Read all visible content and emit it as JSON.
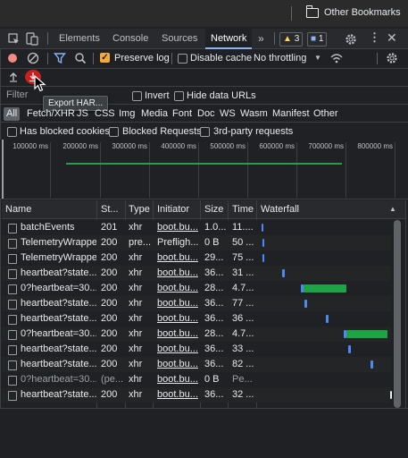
{
  "browser": {
    "bookmarks_label": "Other Bookmarks"
  },
  "devtools": {
    "tabs": [
      "Elements",
      "Console",
      "Sources",
      "Network"
    ],
    "active_tab": "Network",
    "warnings_count": "3",
    "messages_count": "1"
  },
  "toolbar": {
    "preserve_log": "Preserve log",
    "disable_cache": "Disable cache",
    "throttling": "No throttling",
    "filter_placeholder": "Filter",
    "invert": "Invert",
    "hide_data_urls": "Hide data URLs",
    "tooltip": "Export HAR..."
  },
  "filters": [
    "All",
    "Fetch/XHR",
    "JS",
    "CSS",
    "Img",
    "Media",
    "Font",
    "Doc",
    "WS",
    "Wasm",
    "Manifest",
    "Other"
  ],
  "options": {
    "blocked_cookies": "Has blocked cookies",
    "blocked_requests": "Blocked Requests",
    "third_party": "3rd-party requests"
  },
  "overview": {
    "ticks": [
      "100000 ms",
      "200000 ms",
      "300000 ms",
      "400000 ms",
      "500000 ms",
      "600000 ms",
      "700000 ms",
      "800000 ms"
    ]
  },
  "table": {
    "headers": {
      "name": "Name",
      "status": "St...",
      "type": "Type",
      "initiator": "Initiator",
      "size": "Size",
      "time": "Time",
      "waterfall": "Waterfall"
    },
    "rows": [
      {
        "name": "batchEvents",
        "status": "201",
        "type": "xhr",
        "initiator": "boot.bu...",
        "size": "1.0...",
        "time": "11...."
      },
      {
        "name": "TelemetryWrapper",
        "status": "200",
        "type": "pre...",
        "initiator": "Prefligh...",
        "size": "0 B",
        "time": "50 ..."
      },
      {
        "name": "TelemetryWrapper",
        "status": "200",
        "type": "xhr",
        "initiator": "boot.bu...",
        "size": "29...",
        "time": "75 ..."
      },
      {
        "name": "heartbeat?state...",
        "status": "200",
        "type": "xhr",
        "initiator": "boot.bu...",
        "size": "36...",
        "time": "31 ..."
      },
      {
        "name": "0?heartbeat=30...",
        "status": "200",
        "type": "xhr",
        "initiator": "boot.bu...",
        "size": "28...",
        "time": "4.7..."
      },
      {
        "name": "heartbeat?state...",
        "status": "200",
        "type": "xhr",
        "initiator": "boot.bu...",
        "size": "36...",
        "time": "77 ..."
      },
      {
        "name": "heartbeat?state...",
        "status": "200",
        "type": "xhr",
        "initiator": "boot.bu...",
        "size": "36...",
        "time": "36 ..."
      },
      {
        "name": "0?heartbeat=30...",
        "status": "200",
        "type": "xhr",
        "initiator": "boot.bu...",
        "size": "28...",
        "time": "4.7..."
      },
      {
        "name": "heartbeat?state...",
        "status": "200",
        "type": "xhr",
        "initiator": "boot.bu...",
        "size": "36...",
        "time": "33 ..."
      },
      {
        "name": "heartbeat?state...",
        "status": "200",
        "type": "xhr",
        "initiator": "boot.bu...",
        "size": "36...",
        "time": "82 ..."
      },
      {
        "name": "0?heartbeat=30...",
        "status": "(pe...",
        "type": "xhr",
        "initiator": "boot.bu...",
        "size": "0 B",
        "time": "Pe..."
      },
      {
        "name": "heartbeat?state...",
        "status": "200",
        "type": "xhr",
        "initiator": "boot.bu...",
        "size": "36...",
        "time": "32 ..."
      }
    ]
  },
  "colors": {
    "accent": "#8ab4f8",
    "record_red": "#f28b82",
    "stop_red": "#c5221f",
    "waterfall_green": "#1ea446",
    "waterfall_blue": "#4c8bf5"
  }
}
